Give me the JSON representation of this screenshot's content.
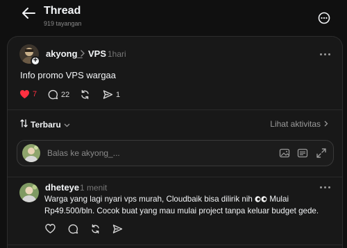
{
  "header": {
    "title": "Thread",
    "views": "919 tayangan"
  },
  "post": {
    "author": "akyong_",
    "topic": "VPS",
    "time": "1hari",
    "text": "Info promo VPS wargaa",
    "likes": "7",
    "replies": "22",
    "shares": "1",
    "like_color": "#ff3040"
  },
  "sort": {
    "label": "Terbaru",
    "activity_link": "Lihat aktivitas"
  },
  "reply_box": {
    "placeholder": "Balas ke akyong_..."
  },
  "comment": {
    "author": "dheteye",
    "time": "1 menit",
    "text_line1": "Warga yang lagi nyari vps murah, Cloudbaik bisa dilirik nih",
    "text_line1_end": "Mulai",
    "text_line2": "Rp49.500/bln. Cocok buat yang mau mulai project tanpa keluar budget gede."
  },
  "colors": {
    "background": "#101010",
    "card": "#181818",
    "border": "#2d2d2d",
    "muted": "#8a8a8a",
    "like": "#ff3040"
  },
  "icons": [
    "back-arrow-icon",
    "more-circle-icon",
    "plus-icon",
    "chevron-right-icon",
    "heart-icon",
    "comment-icon",
    "repost-icon",
    "share-icon",
    "sort-icon",
    "chevron-down-icon",
    "gif-icon",
    "image-icon",
    "expand-icon",
    "eyes-emoji-icon"
  ]
}
